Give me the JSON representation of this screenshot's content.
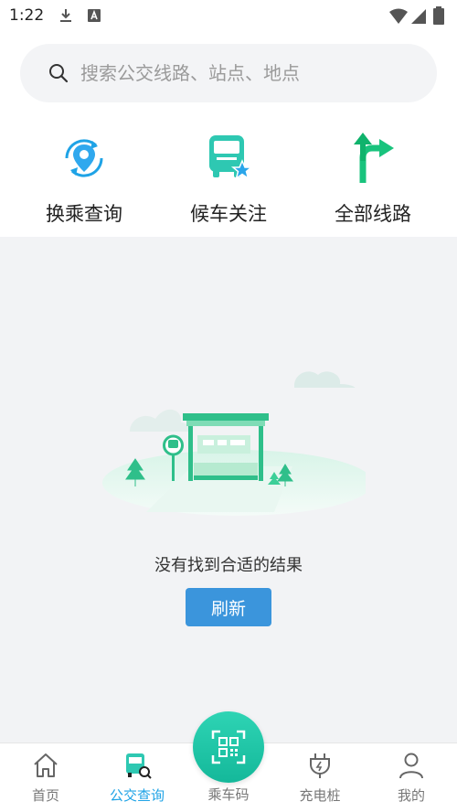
{
  "status_bar": {
    "time": "1:22",
    "icons": [
      "download-icon",
      "font-a-icon",
      "wifi-icon",
      "signal-icon",
      "battery-icon"
    ]
  },
  "search": {
    "placeholder": "搜索公交线路、站点、地点"
  },
  "quick_actions": [
    {
      "label": "换乘查询",
      "icon": "transfer-location-icon"
    },
    {
      "label": "候车关注",
      "icon": "bus-favorite-icon"
    },
    {
      "label": "全部线路",
      "icon": "route-arrows-icon"
    }
  ],
  "empty_state": {
    "message": "没有找到合适的结果",
    "refresh_label": "刷新"
  },
  "bottom_nav": {
    "items": [
      {
        "label": "首页",
        "icon": "home-icon",
        "active": false
      },
      {
        "label": "公交查询",
        "icon": "bus-search-icon",
        "active": true
      },
      {
        "label": "乘车码",
        "icon": "qr-code-icon",
        "active": false
      },
      {
        "label": "充电桩",
        "icon": "charging-plug-icon",
        "active": false
      },
      {
        "label": "我的",
        "icon": "user-icon",
        "active": false
      }
    ]
  },
  "colors": {
    "accent_blue": "#1fa3e6",
    "button_blue": "#3b95dc",
    "green": "#19c37d",
    "teal": "#14b89a",
    "background": "#f2f3f5"
  }
}
